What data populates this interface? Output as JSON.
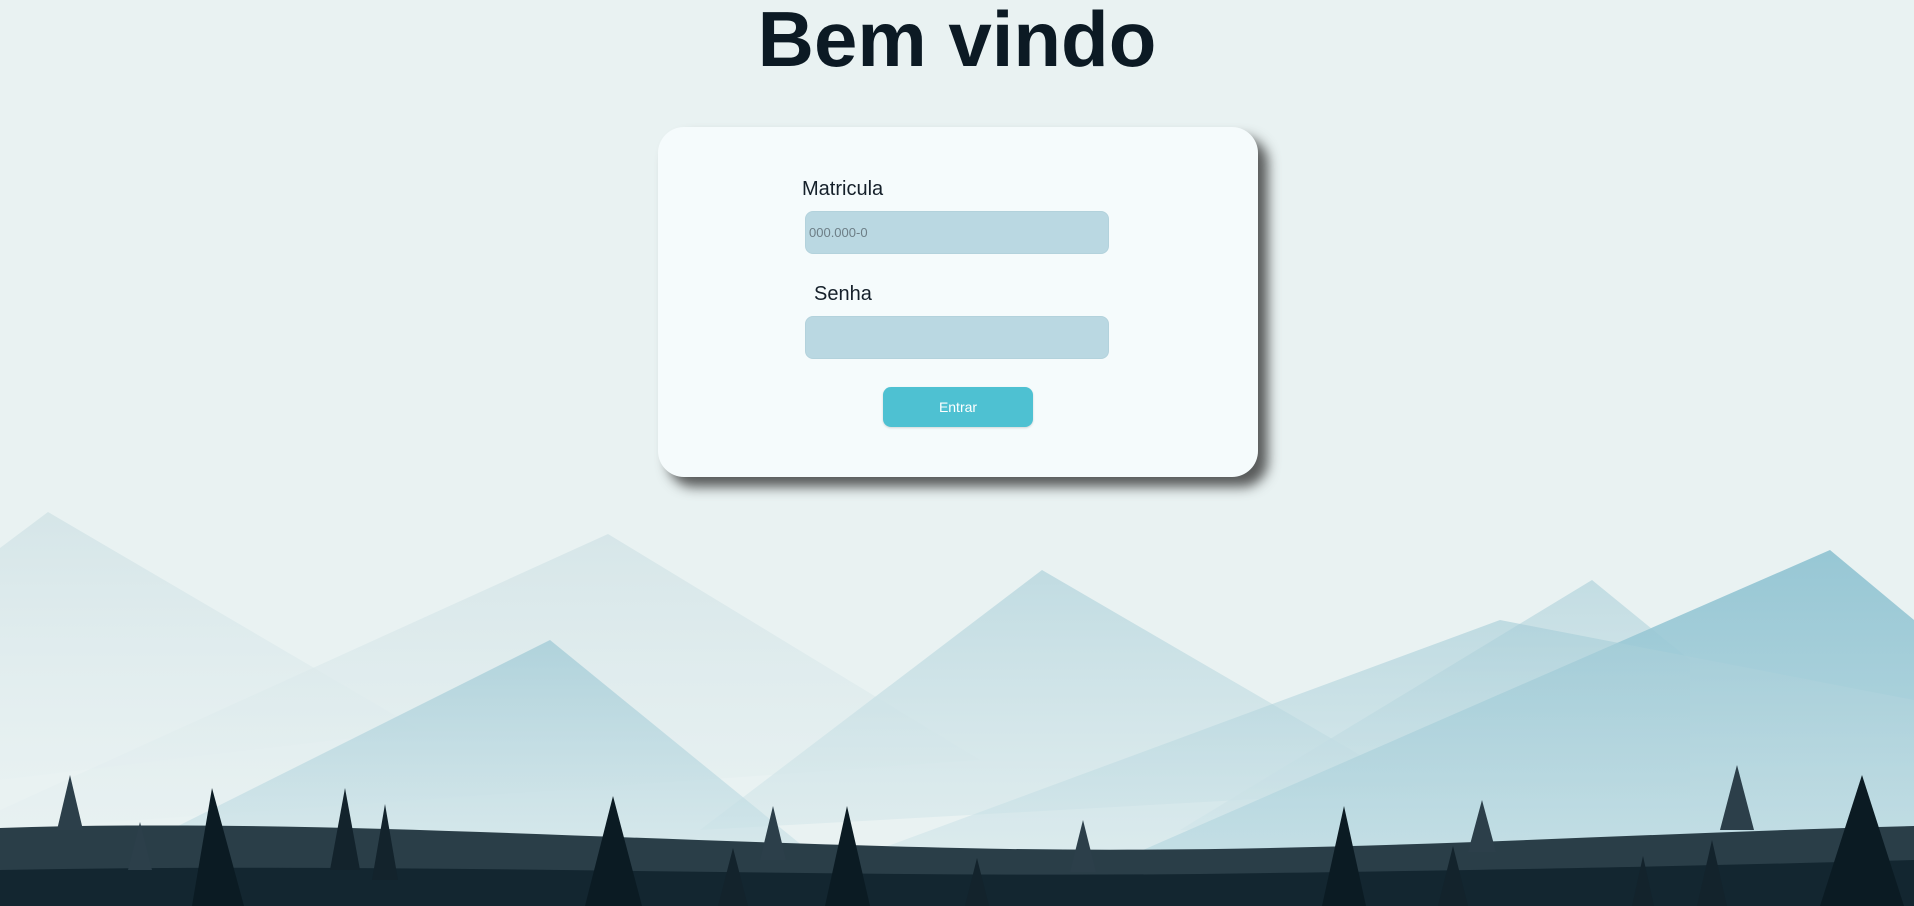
{
  "page": {
    "title": "Bem vindo"
  },
  "login_form": {
    "matricula_label": "Matricula",
    "matricula_placeholder": "000.000-0",
    "matricula_value": "",
    "senha_label": "Senha",
    "senha_value": "",
    "submit_label": "Entrar"
  },
  "colors": {
    "background": "#e9f2f2",
    "title": "#0c1a24",
    "card": "#f5fbfc",
    "input": "#bad8e2",
    "button": "#4ec1d2",
    "mountain_light": "#cfe2e6",
    "mountain_mid": "#a5cfd9",
    "ground_dark": "#0a1a22"
  }
}
